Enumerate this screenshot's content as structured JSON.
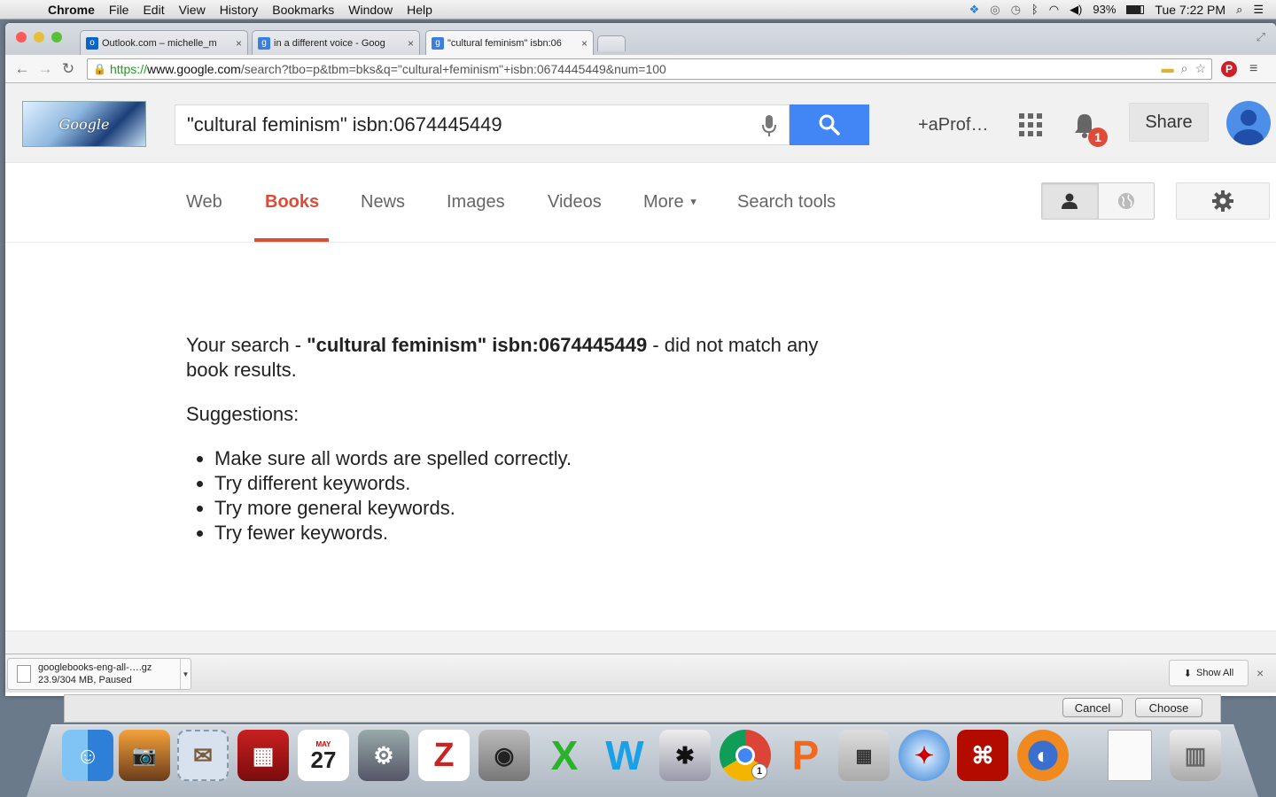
{
  "menubar": {
    "app": "Chrome",
    "items": [
      "File",
      "Edit",
      "View",
      "History",
      "Bookmarks",
      "Window",
      "Help"
    ],
    "battery": "93%",
    "clock": "Tue 7:22 PM"
  },
  "browser": {
    "tabs": [
      {
        "title": "Outlook.com – michelle_m",
        "close": "×"
      },
      {
        "title": "in a different voice - Goog",
        "close": "×"
      },
      {
        "title": "\"cultural feminism\" isbn:06",
        "close": "×"
      }
    ],
    "url": {
      "scheme": "https://",
      "host": "www.google.com",
      "path": "/search?tbo=p&tbm=bks&q=\"cultural+feminism\"+isbn:0674445449&num=100"
    }
  },
  "google": {
    "query": "\"cultural feminism\" isbn:0674445449",
    "profile_link": "+aProf…",
    "notification_count": "1",
    "share_label": "Share",
    "tabs": [
      {
        "label": "Web"
      },
      {
        "label": "Books"
      },
      {
        "label": "News"
      },
      {
        "label": "Images"
      },
      {
        "label": "Videos"
      },
      {
        "label": "More"
      },
      {
        "label": "Search tools"
      }
    ],
    "selected_tab": "Books"
  },
  "results": {
    "prefix": "Your search - ",
    "query_bold": "\"cultural feminism\" isbn:0674445449",
    "suffix": " - did not match any book results.",
    "suggestions_heading": "Suggestions:",
    "suggestions": [
      "Make sure all words are spelled correctly.",
      "Try different keywords.",
      "Try more general keywords.",
      "Try fewer keywords."
    ]
  },
  "downloads": {
    "filename": "googlebooks-eng-all-….gz",
    "status": "23.9/304 MB, Paused",
    "show_all": "Show All",
    "close": "×"
  },
  "dialog": {
    "cancel": "Cancel",
    "choose": "Choose"
  },
  "dock": {
    "calendar_month": "MAY",
    "calendar_day": "27",
    "chrome_badge": "1"
  },
  "colors": {
    "google_blue": "#4285f4",
    "selected_tab_red": "#dd4b39",
    "notification_red": "#dd4b39"
  }
}
